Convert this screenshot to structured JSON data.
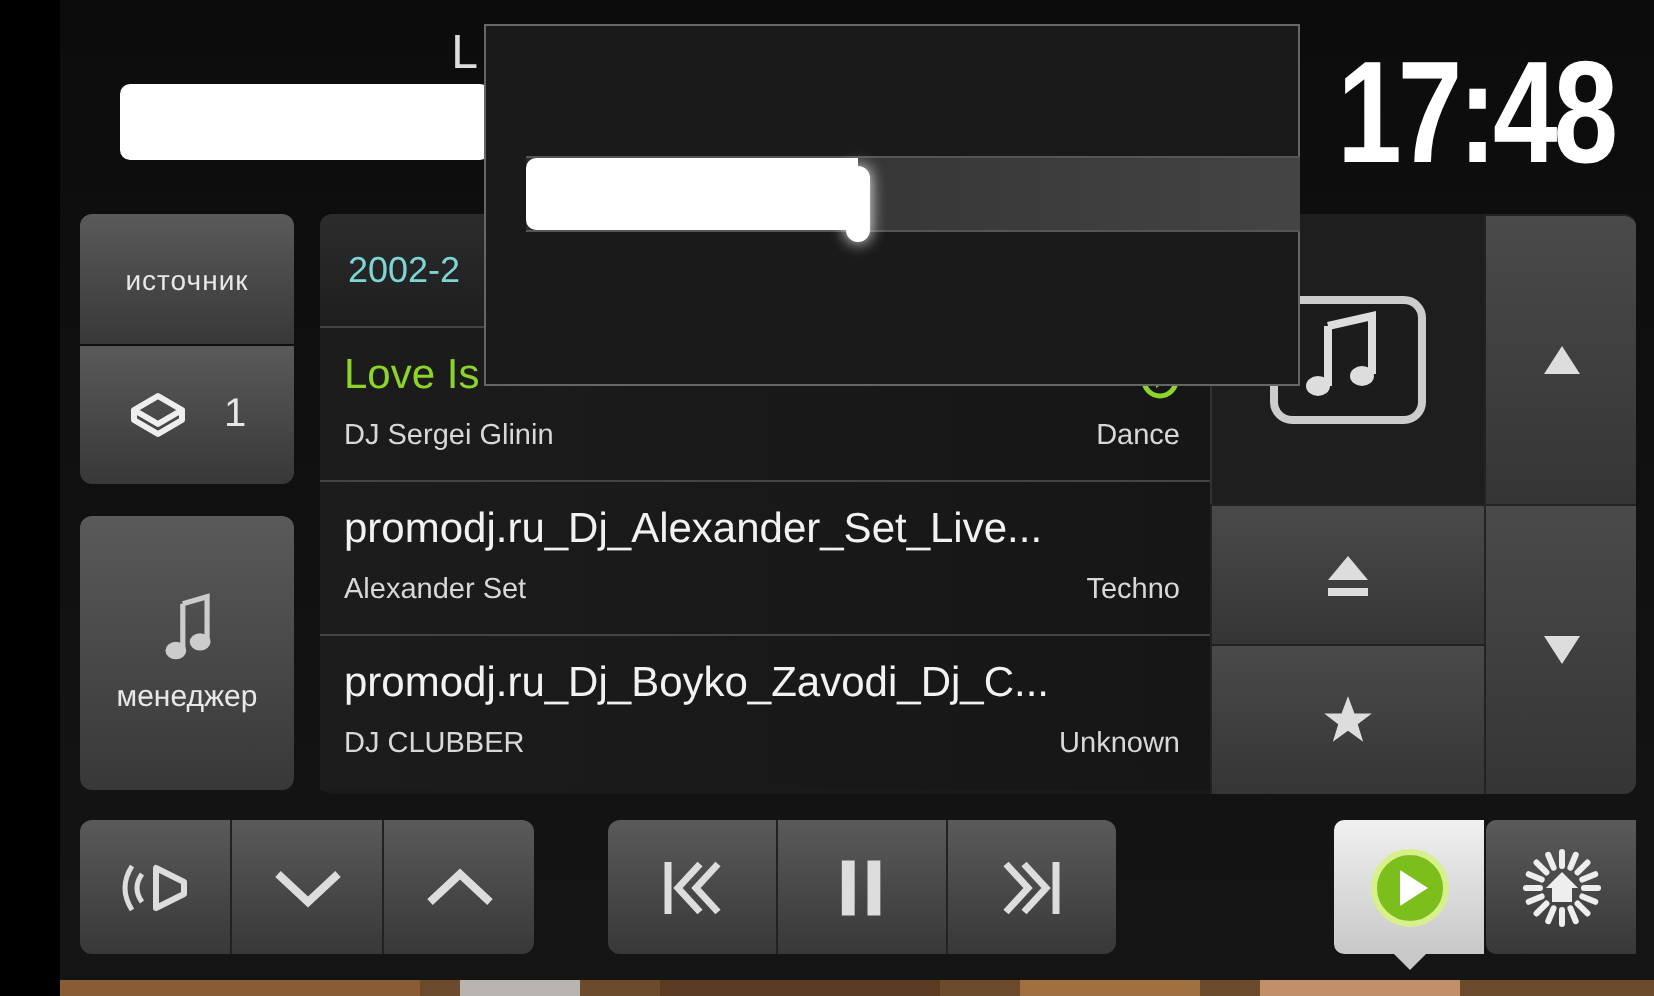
{
  "header": {
    "title": "L",
    "clock": "17:48"
  },
  "overlay": {
    "slider": {
      "level": 0.43
    }
  },
  "source_button": {
    "label": "источник"
  },
  "layer_button": {
    "label": "1"
  },
  "manager_button": {
    "label": "менеджер"
  },
  "playlist": {
    "header": "2002-2",
    "tracks": [
      {
        "title": "Love Is",
        "artist": "DJ Sergei Glinin",
        "genre": "Dance",
        "playing": true
      },
      {
        "title": "promodj.ru_Dj_Alexander_Set_Live...",
        "artist": "Alexander Set",
        "genre": "Techno",
        "playing": false
      },
      {
        "title": "promodj.ru_Dj_Boyko_Zavodi_Dj_C...",
        "artist": "DJ CLUBBER",
        "genre": "Unknown",
        "playing": false
      }
    ]
  },
  "bottom_nav": [
    {
      "kind": "player",
      "selected": true
    },
    {
      "kind": "home",
      "selected": false
    }
  ]
}
